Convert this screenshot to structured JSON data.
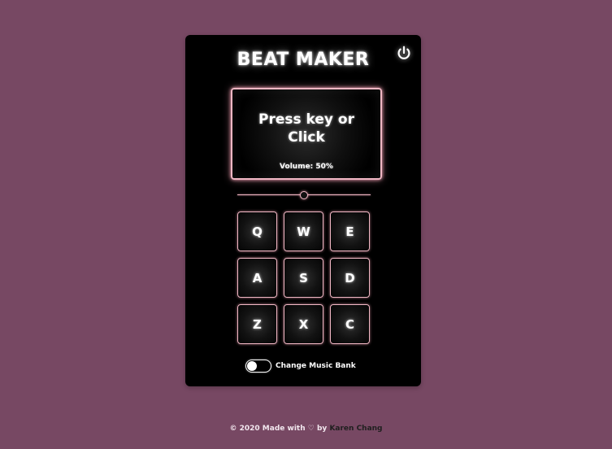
{
  "app": {
    "title": "BEAT MAKER",
    "display_text": "Press key or\nClick",
    "volume_label": "Volume: 50%",
    "volume_value": 0.5,
    "power_icon": "power-icon",
    "pads": [
      "Q",
      "W",
      "E",
      "A",
      "S",
      "D",
      "Z",
      "X",
      "C"
    ],
    "toggle_label": "Change Music Bank",
    "toggle_on": false,
    "colors": {
      "background": "#774863",
      "panel": "#000000",
      "accent": "#f0b7c4",
      "text": "#ffffff"
    }
  },
  "footer": {
    "copyright": "© 2020 Made with",
    "heart": "♡",
    "by": "by",
    "author": "Karen Chang"
  }
}
